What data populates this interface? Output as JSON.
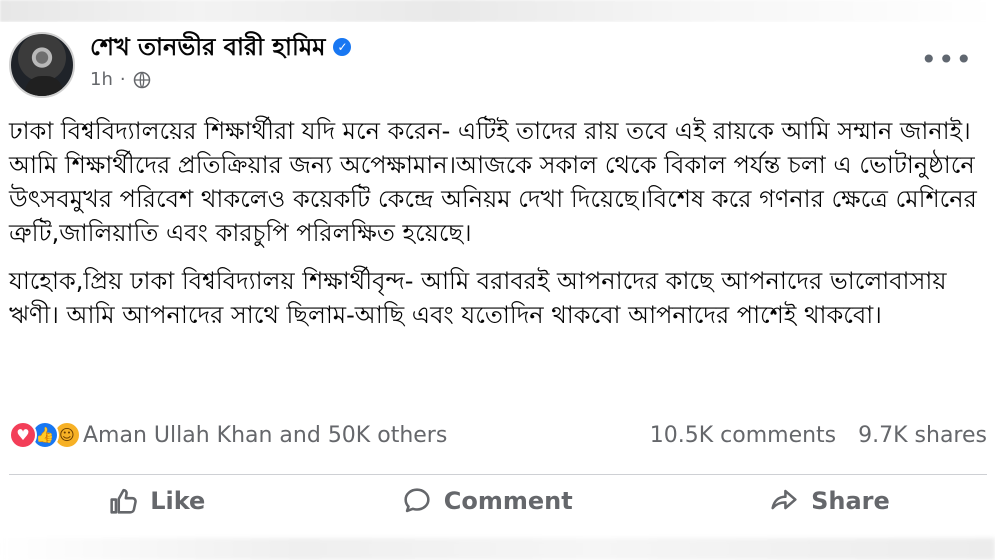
{
  "post": {
    "author": "শেখ তানভীর বারী হামিম",
    "time": "1h",
    "paragraphs": [
      "ঢাকা বিশ্ববিদ্যালয়ের শিক্ষার্থীরা যদি মনে করেন- এটিই তাদের রায় তবে এই রায়কে আমি সম্মান জানাই।আমি শিক্ষার্থীদের প্রতিক্রিয়ার জন্য অপেক্ষামান।আজকে সকাল থেকে বিকাল পর্যন্ত চলা এ ভোটানুষ্ঠানে উৎসবমুখর পরিবেশ থাকলেও কয়েকটি কেন্দ্রে অনিয়ম দেখা দিয়েছে।বিশেষ করে গণনার ক্ষেত্রে মেশিনের ত্রুটি,জালিয়াতি এবং কারচুপি পরিলক্ষিত হয়েছে।",
      "যাহোক,প্রিয় ঢাকা বিশ্ববিদ্যালয় শিক্ষার্থীবৃন্দ- আমি বরাবরই আপনাদের কাছে আপনাদের ভালোবাসায় ঋণী। আমি আপনাদের সাথে ছিলাম-আছি এবং যতোদিন থাকবো আপনাদের পাশেই থাকবো।"
    ],
    "reactions_text": "Aman Ullah Khan and 50K others",
    "comments": "10.5K comments",
    "shares": "9.7K shares",
    "reaction_icons": [
      "love-icon",
      "like-icon",
      "care-icon"
    ]
  },
  "actions": {
    "like": "Like",
    "comment": "Comment",
    "share": "Share"
  },
  "colors": {
    "verified": "#1877f2",
    "secondary_text": "#65676b",
    "love": "#f33e58",
    "like": "#1877f2",
    "care": "#f7b125"
  }
}
